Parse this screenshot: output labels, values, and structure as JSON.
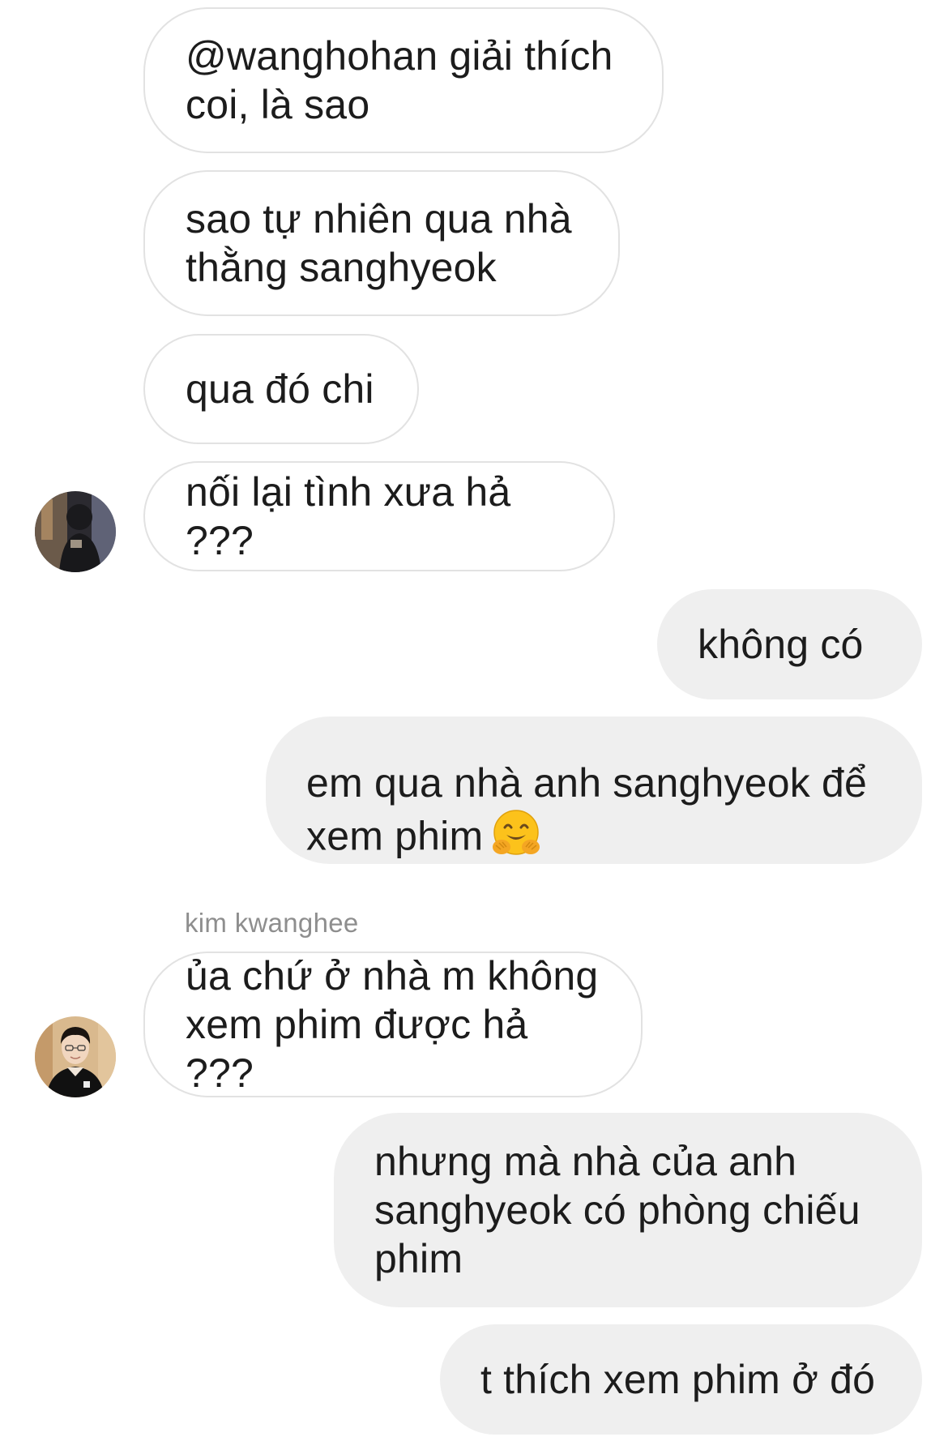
{
  "chat": {
    "messages": [
      {
        "side": "in",
        "text": "@wanghohan giải thích\ncoi, là sao"
      },
      {
        "side": "in",
        "text": "sao tự nhiên qua nhà\nthằng sanghyeok"
      },
      {
        "side": "in",
        "text": "qua đó chi"
      },
      {
        "side": "in",
        "text": "nối lại tình xưa hả ???"
      },
      {
        "side": "out",
        "text": "không có"
      },
      {
        "side": "out",
        "text": "em qua nhà anh sanghyeok để\nxem phim",
        "emoji": "hugging-face-emoji"
      },
      {
        "side": "in",
        "text": "ủa chứ ở nhà m không\nxem phim được hả ???"
      },
      {
        "side": "out",
        "text": "nhưng mà nhà của anh\nsanghyeok có phòng chiếu\nphim"
      },
      {
        "side": "out",
        "text": "t thích xem phim ở đó"
      }
    ],
    "sender_label": "kim kwanghee",
    "colors": {
      "incoming_bg": "#ffffff",
      "incoming_border": "#e2e2e2",
      "outgoing_bg": "#efefef",
      "text": "#1c1c1c",
      "sender": "#8e8e8e"
    }
  }
}
